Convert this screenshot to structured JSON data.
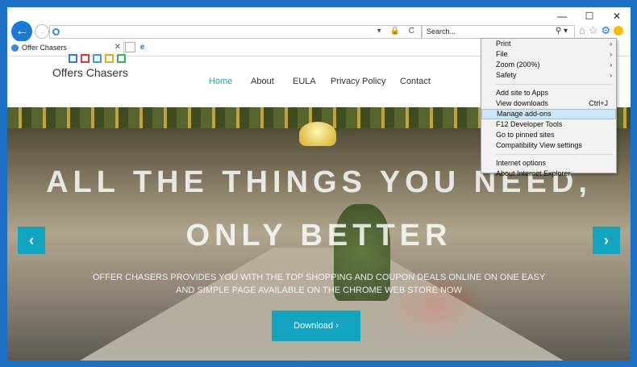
{
  "browser": {
    "search_placeholder": "Search...",
    "tab_title": "Offer Chasers",
    "win_min": "—",
    "win_max": "☐",
    "win_close": "✕",
    "back_glyph": "←",
    "fwd_glyph": "→",
    "addr_ctrls": "▾ 🔒 C",
    "search_glyph": "⚲ ▾",
    "home_glyph": "⌂",
    "star_glyph": "☆",
    "gear_glyph": "⚙",
    "tab_close_glyph": "✕",
    "ie_glyph": "e"
  },
  "site": {
    "logo_text": "Offers Chasers",
    "logo_colors": [
      "#3a7bd5",
      "#d63a3a",
      "#3aa0d5",
      "#e0b020",
      "#3ab55a"
    ],
    "nav": [
      {
        "label": "Home",
        "active": true
      },
      {
        "label": "About",
        "active": false
      },
      {
        "label": "EULA",
        "active": false
      },
      {
        "label": "Privacy Policy",
        "active": false
      },
      {
        "label": "Contact",
        "active": false
      }
    ],
    "hero_line1": "ALL THE THINGS YOU NEED,",
    "hero_line2": "ONLY BETTER",
    "hero_paragraph": "OFFER CHASERS PROVIDES YOU WITH THE TOP SHOPPING AND COUPON DEALS ONLINE ON ONE EASY AND SIMPLE PAGE AVAILABLE ON THE CHROME WEB STORE NOW",
    "download_label": "Download ›",
    "prev_glyph": "‹",
    "next_glyph": "›"
  },
  "tools_menu": {
    "items": [
      {
        "label": "Print",
        "submenu": true
      },
      {
        "label": "File",
        "submenu": true
      },
      {
        "label": "Zoom (200%)",
        "submenu": true
      },
      {
        "label": "Safety",
        "submenu": true
      },
      {
        "separator": true
      },
      {
        "label": "Add site to Apps"
      },
      {
        "label": "View downloads",
        "shortcut": "Ctrl+J"
      },
      {
        "label": "Manage add-ons",
        "highlighted": true
      },
      {
        "label": "F12 Developer Tools"
      },
      {
        "label": "Go to pinned sites"
      },
      {
        "label": "Compatibility View settings"
      },
      {
        "separator": true
      },
      {
        "label": "Internet options"
      },
      {
        "label": "About Internet Explorer"
      }
    ],
    "submenu_glyph": "›"
  },
  "colors": {
    "accent": "#13a5bf",
    "ie_blue": "#1b7ad6",
    "menu_highlight": "#cde6f7"
  }
}
